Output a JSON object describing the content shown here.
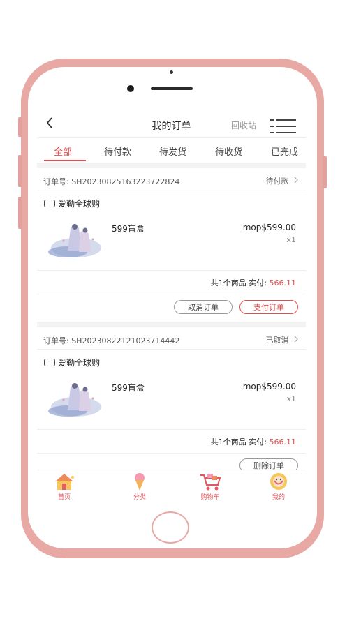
{
  "nav": {
    "back_icon": "chevron-left-icon",
    "title": "我的订单",
    "recycle": "回收站",
    "menu_icon": "menu-icon"
  },
  "tabs": [
    {
      "label": "全部",
      "active": true
    },
    {
      "label": "待付款"
    },
    {
      "label": "待发货"
    },
    {
      "label": "待收货"
    },
    {
      "label": "已完成"
    }
  ],
  "orders": [
    {
      "order_no": "订单号: SH20230825163223722824",
      "status": "待付款",
      "shop": "爱勤全球购",
      "product": "599盲盒",
      "price": "mop$599.00",
      "qty": "x1",
      "summary_prefix": "共1个商品 实付:",
      "amount": "566.11",
      "buttons": [
        "取消订单",
        "支付订单"
      ]
    },
    {
      "order_no": "订单号: SH20230822121023714442",
      "status": "已取消",
      "shop": "爱勤全球购",
      "product": "599盲盒",
      "price": "mop$599.00",
      "qty": "x1",
      "summary_prefix": "共1个商品 实付:",
      "amount": "566.11",
      "buttons": [
        "删除订单"
      ]
    }
  ],
  "tabbar": [
    {
      "label": "首页",
      "icon": "house-icon"
    },
    {
      "label": "分类",
      "icon": "ice-cream-icon"
    },
    {
      "label": "购物车",
      "icon": "shopping-cart-icon"
    },
    {
      "label": "我的",
      "icon": "profile-icon"
    }
  ],
  "colors": {
    "accent": "#e34d4d",
    "phone_frame": "#e8a8a4",
    "tab_label": "#e8555c"
  }
}
